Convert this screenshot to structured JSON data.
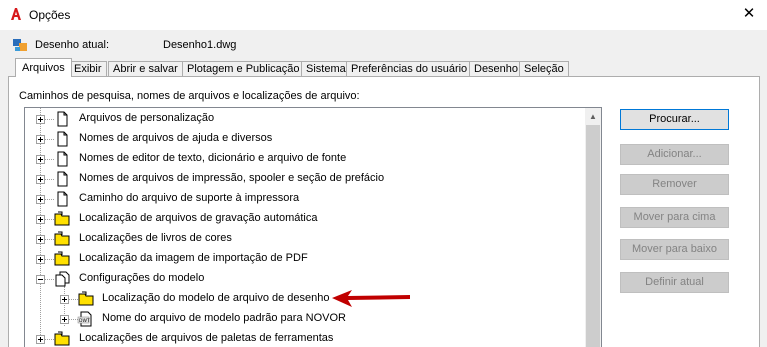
{
  "window": {
    "title": "Opções",
    "close_glyph": "✕"
  },
  "drawing": {
    "label": "Desenho atual:",
    "value": "Desenho1.dwg"
  },
  "tabs": [
    {
      "label": "Arquivos",
      "active": true
    },
    {
      "label": "Exibir"
    },
    {
      "label": "Abrir e salvar"
    },
    {
      "label": "Plotagem e Publicação"
    },
    {
      "label": "Sistema"
    },
    {
      "label": "Preferências do usuário"
    },
    {
      "label": "Desenho"
    },
    {
      "label": "Seleção"
    }
  ],
  "section_label": "Caminhos de pesquisa, nomes de arquivos e localizações de arquivo:",
  "tree": [
    {
      "label": "Arquivos de personalização",
      "icon": "document-icon",
      "level": 0,
      "state": "collapsed"
    },
    {
      "label": "Nomes de arquivos de ajuda e diversos",
      "icon": "document-icon",
      "level": 0,
      "state": "collapsed"
    },
    {
      "label": "Nomes de editor de texto, dicionário e arquivo de fonte",
      "icon": "document-icon",
      "level": 0,
      "state": "collapsed"
    },
    {
      "label": "Nomes de arquivos de impressão, spooler e seção de prefácio",
      "icon": "document-icon",
      "level": 0,
      "state": "collapsed"
    },
    {
      "label": "Caminho do arquivo de suporte à impressora",
      "icon": "document-icon",
      "level": 0,
      "state": "collapsed"
    },
    {
      "label": "Localização de arquivos de gravação automática",
      "icon": "folder-icon",
      "level": 0,
      "state": "collapsed"
    },
    {
      "label": "Localizações de livros de cores",
      "icon": "folder-icon",
      "level": 0,
      "state": "collapsed"
    },
    {
      "label": "Localização da imagem de importação de PDF",
      "icon": "folder-icon",
      "level": 0,
      "state": "collapsed"
    },
    {
      "label": "Configurações do modelo",
      "icon": "documents-icon",
      "level": 0,
      "state": "expanded"
    },
    {
      "label": "Localização do modelo de arquivo de desenho",
      "icon": "folder-icon",
      "level": 1,
      "state": "collapsed"
    },
    {
      "label": "Nome do arquivo de modelo padrão para NOVOR",
      "icon": "dwt-file-icon",
      "level": 1,
      "state": "collapsed"
    },
    {
      "label": "Localizações de arquivos de paletas de ferramentas",
      "icon": "folder-icon",
      "level": 0,
      "state": "collapsed"
    }
  ],
  "buttons": [
    {
      "label": "Procurar...",
      "enabled": true
    },
    {
      "label": "Adicionar...",
      "enabled": false
    },
    {
      "label": "Remover",
      "enabled": false
    },
    {
      "label": "Mover para cima",
      "enabled": false
    },
    {
      "label": "Mover para baixo",
      "enabled": false
    },
    {
      "label": "Definir atual",
      "enabled": false
    }
  ],
  "colors": {
    "folder": "#ffe000",
    "arrow": "#c00000",
    "selection_border": "#0078d7"
  }
}
